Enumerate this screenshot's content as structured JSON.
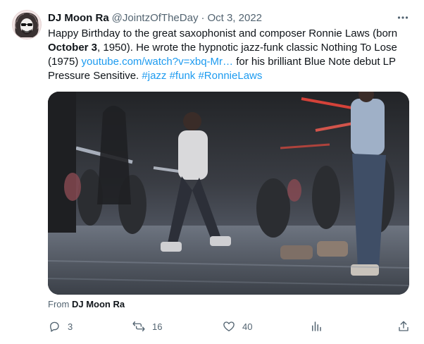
{
  "author": {
    "name": "DJ Moon Ra",
    "handle": "@JointzOfTheDay",
    "separator": "·",
    "date": "Oct 3, 2022"
  },
  "tweet": {
    "text_1": "Happy Birthday to the great saxophonist and composer Ronnie Laws (born ",
    "text_bold": "October 3",
    "text_2": ", 1950). He wrote the hypnotic jazz-funk classic Nothing To Lose (1975) ",
    "link": "youtube.com/watch?v=xbq-Mr…",
    "text_3": " for his brilliant Blue Note debut LP Pressure Sensitive. ",
    "hashtags": [
      "#jazz",
      "#funk",
      "#RonnieLaws"
    ]
  },
  "media": {
    "from_label": "From",
    "from_name": "DJ Moon Ra"
  },
  "actions": {
    "replies": "3",
    "retweets": "16",
    "likes": "40"
  },
  "icons": [
    "more-icon",
    "reply-icon",
    "retweet-icon",
    "like-icon",
    "views-icon",
    "share-icon"
  ]
}
